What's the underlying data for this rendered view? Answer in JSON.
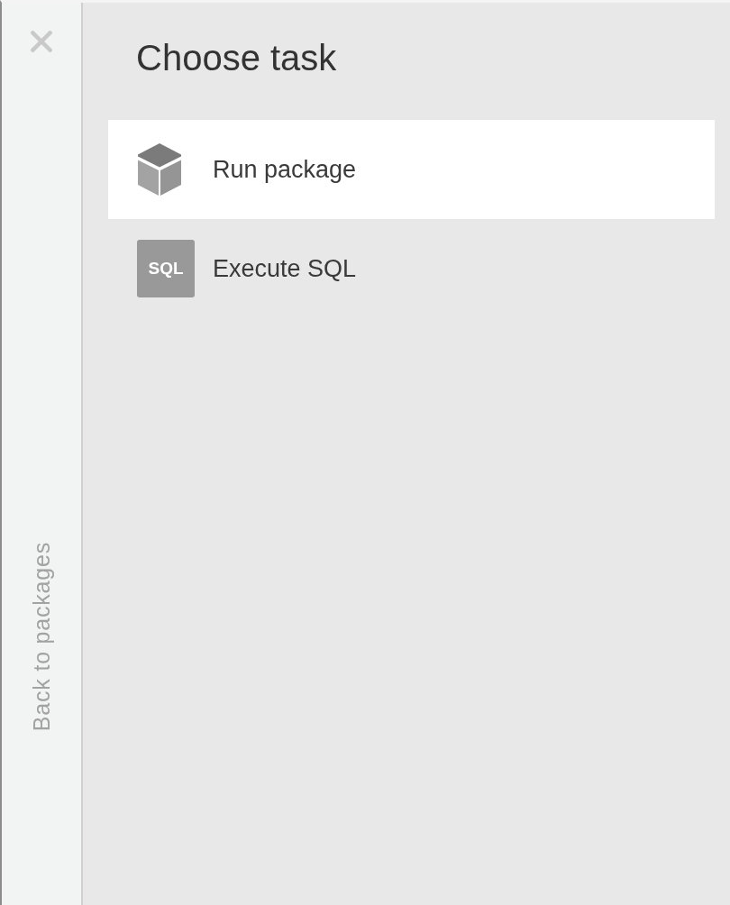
{
  "sidebar": {
    "back_link": "Back to packages"
  },
  "title": "Choose task",
  "tasks": [
    {
      "kind": "package",
      "label": "Run package",
      "selected": true
    },
    {
      "kind": "sql",
      "label": "Execute SQL",
      "icon_text": "SQL",
      "selected": false
    }
  ]
}
